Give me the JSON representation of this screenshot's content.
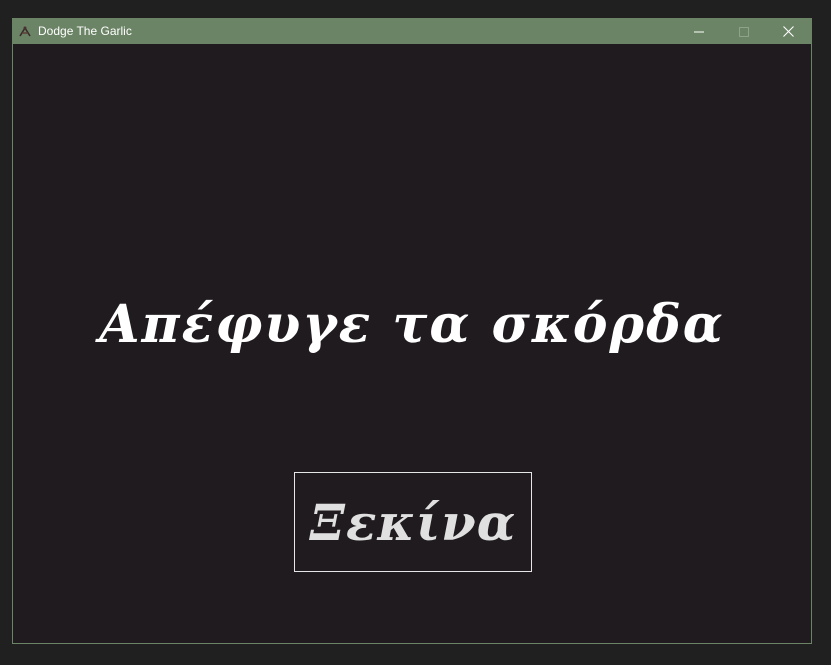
{
  "window": {
    "title": "Dodge The Garlic",
    "app_icon": "garlic-icon",
    "controls": {
      "minimize_icon": "minimize-icon",
      "maximize_icon": "maximize-icon",
      "close_icon": "close-icon"
    }
  },
  "game": {
    "title": "Απέφυγε τα σκόρδα",
    "start_button_label": "Ξεκίνα"
  },
  "colors": {
    "titlebar": "#6b8466",
    "background": "#1f1b1e",
    "text": "#ffffff",
    "button_border": "#e6e6e6"
  }
}
